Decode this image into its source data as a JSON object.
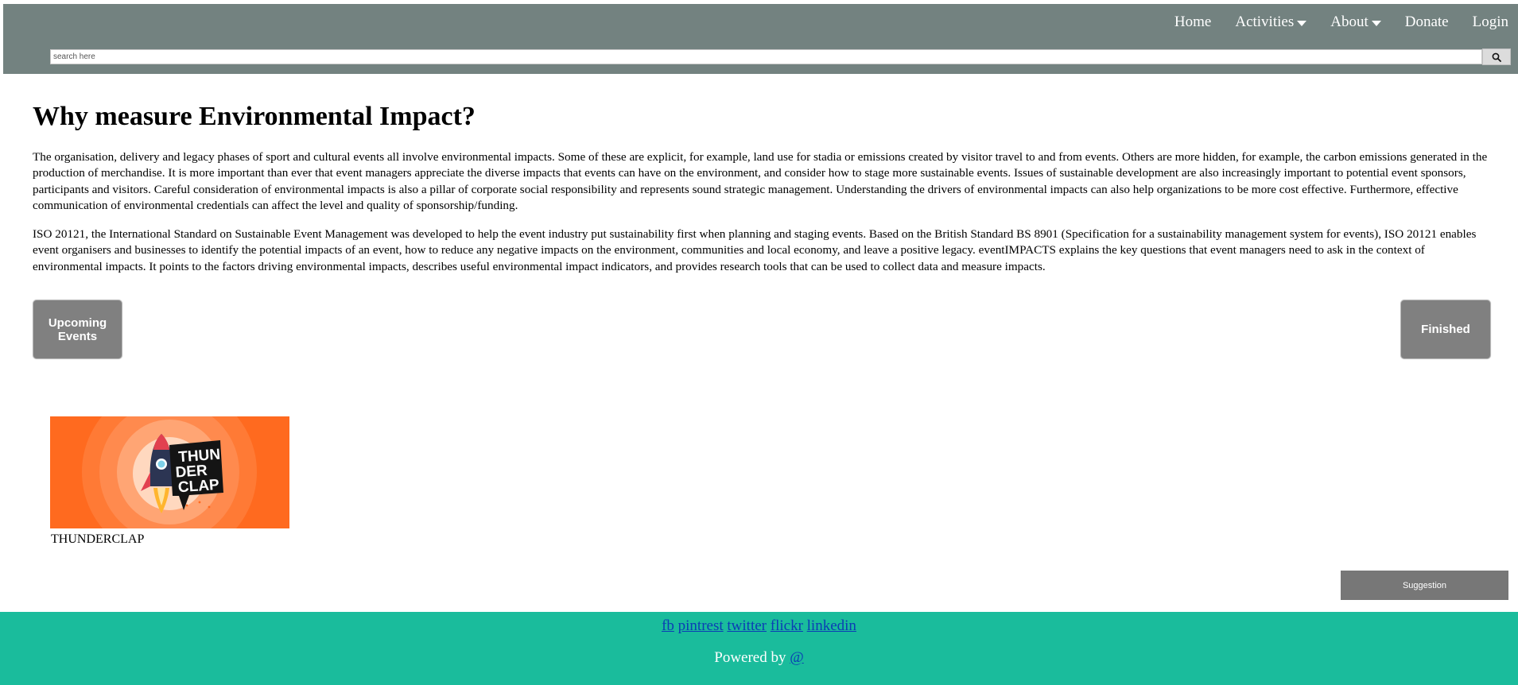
{
  "header": {
    "nav": [
      {
        "label": "Home"
      },
      {
        "label": "Activities"
      },
      {
        "label": "About"
      },
      {
        "label": "Donate"
      },
      {
        "label": "Login"
      }
    ],
    "search": {
      "placeholder": "search here",
      "value": "",
      "icon": "search-icon"
    }
  },
  "main": {
    "title": "Why measure Environmental Impact?",
    "paragraphs": [
      "The organisation, delivery and legacy phases of sport and cultural events all involve environmental impacts. Some of these are explicit, for example, land use for stadia or emissions created by visitor travel to and from events. Others are more hidden, for example, the carbon emissions generated in the production of merchandise. It is more important than ever that event managers appreciate the diverse impacts that events can have on the environment, and consider how to stage more sustainable events. Issues of sustainable development are also increasingly important to potential event sponsors, participants and visitors. Careful consideration of environmental impacts is also a pillar of corporate social responsibility and represents sound strategic management. Understanding the drivers of environmental impacts can also help organizations to be more cost effective. Furthermore, effective communication of environmental credentials can affect the level and quality of sponsorship/funding.",
      "ISO 20121, the International Standard on Sustainable Event Management was developed to help the event industry put sustainability first when planning and staging events. Based on the British Standard BS 8901 (Specification for a sustainability management system for events), ISO 20121 enables event organisers and businesses to identify the potential impacts of an event, how to reduce any negative impacts on the environment, communities and local economy, and leave a positive legacy. eventIMPACTS explains the key questions that event managers need to ask in the context of environmental impacts. It points to the factors driving environmental impacts, describes useful environmental impact indicators, and provides research tools that can be used to collect data and measure impacts."
    ],
    "buttons": {
      "upcoming": "Upcoming Events",
      "finished": "Finished"
    },
    "event": {
      "title": "THUNDERCLAP",
      "logo_text": [
        "THUN",
        "DER",
        "CLAP"
      ]
    },
    "suggestion": "Suggestion"
  },
  "footer": {
    "links": [
      "fb",
      "pintrest",
      "twitter",
      "flickr",
      "linkedin"
    ],
    "powered_label": "Powered by",
    "powered_link": "@"
  },
  "colors": {
    "header_bg": "#738280",
    "footer_bg": "#1abc9c",
    "button_bg": "#808080",
    "thumb_orange": "#ff6a1f",
    "link_blue": "#0b3db5"
  }
}
